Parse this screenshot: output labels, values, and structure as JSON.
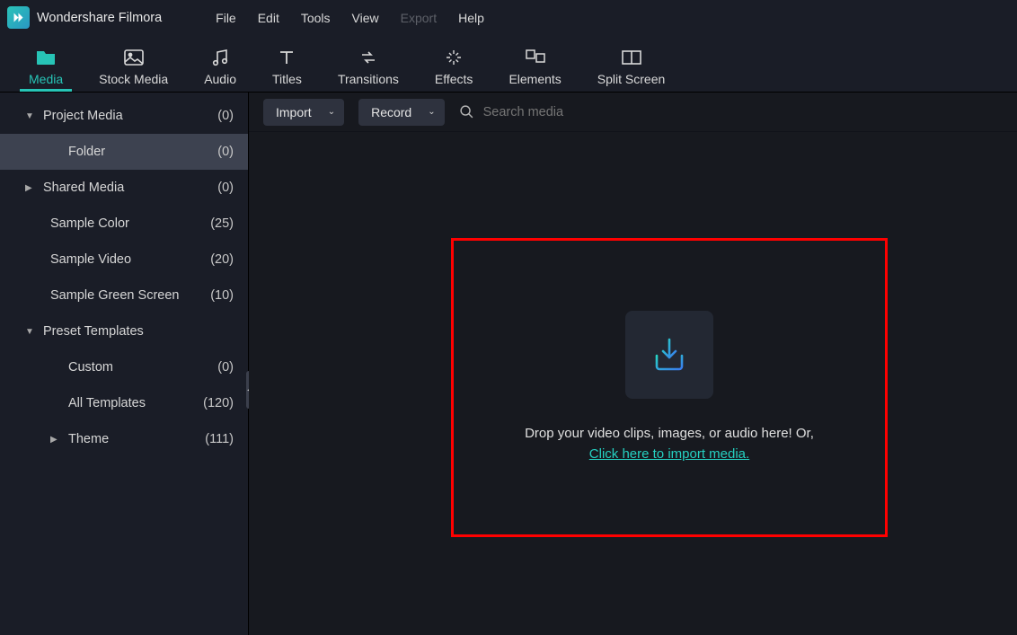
{
  "app_title": "Wondershare Filmora",
  "menu": {
    "file": "File",
    "edit": "Edit",
    "tools": "Tools",
    "view": "View",
    "export": "Export",
    "help": "Help"
  },
  "tabs": {
    "media": "Media",
    "stock": "Stock Media",
    "audio": "Audio",
    "titles": "Titles",
    "transitions": "Transitions",
    "effects": "Effects",
    "elements": "Elements",
    "split": "Split Screen"
  },
  "sidebar": {
    "project_media": {
      "label": "Project Media",
      "count": "(0)"
    },
    "folder": {
      "label": "Folder",
      "count": "(0)"
    },
    "shared_media": {
      "label": "Shared Media",
      "count": "(0)"
    },
    "sample_color": {
      "label": "Sample Color",
      "count": "(25)"
    },
    "sample_video": {
      "label": "Sample Video",
      "count": "(20)"
    },
    "sample_green": {
      "label": "Sample Green Screen",
      "count": "(10)"
    },
    "preset_templates": {
      "label": "Preset Templates",
      "count": ""
    },
    "custom": {
      "label": "Custom",
      "count": "(0)"
    },
    "all_templates": {
      "label": "All Templates",
      "count": "(120)"
    },
    "theme": {
      "label": "Theme",
      "count": "(111)"
    }
  },
  "main": {
    "import_label": "Import",
    "record_label": "Record",
    "search_placeholder": "Search media",
    "drop_text": "Drop your video clips, images, or audio here! Or,",
    "drop_link": "Click here to import media."
  }
}
